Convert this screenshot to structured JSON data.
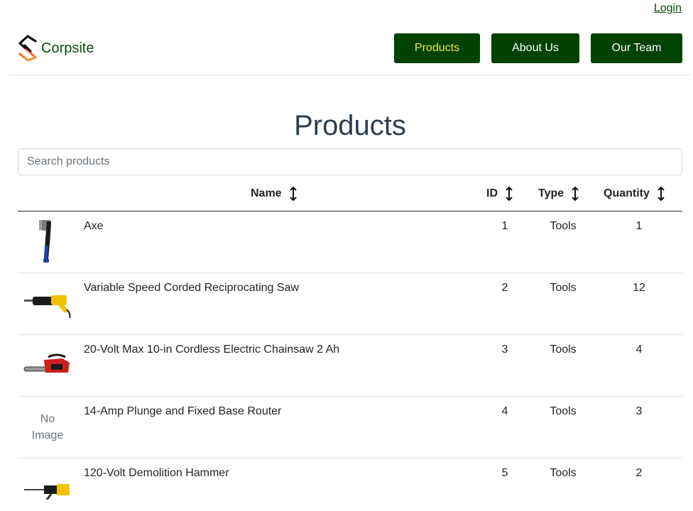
{
  "header": {
    "login_label": "Login",
    "brand_name": "Corpsite",
    "nav": {
      "products": "Products",
      "about": "About Us",
      "team": "Our Team"
    },
    "colors": {
      "nav_bg": "#004200",
      "nav_active_text": "#f3e34a",
      "brand_text": "#0b4d0b"
    }
  },
  "main": {
    "title": "Products",
    "search_placeholder": "Search products",
    "columns": {
      "name": "Name",
      "id": "ID",
      "type": "Type",
      "quantity": "Quantity"
    },
    "products": [
      {
        "name": "Axe",
        "id": "1",
        "type": "Tools",
        "quantity": "1",
        "image": "axe"
      },
      {
        "name": "Variable Speed Corded Reciprocating Saw",
        "id": "2",
        "type": "Tools",
        "quantity": "12",
        "image": "reciprocating-saw"
      },
      {
        "name": "20-Volt Max 10-in Cordless Electric Chainsaw 2 Ah",
        "id": "3",
        "type": "Tools",
        "quantity": "4",
        "image": "chainsaw"
      },
      {
        "name": "14-Amp Plunge and Fixed Base Router",
        "id": "4",
        "type": "Tools",
        "quantity": "3",
        "image": "none",
        "no_image_line1": "No",
        "no_image_line2": "Image"
      },
      {
        "name": "120-Volt Demolition Hammer",
        "id": "5",
        "type": "Tools",
        "quantity": "2",
        "image": "demolition-hammer"
      }
    ]
  }
}
